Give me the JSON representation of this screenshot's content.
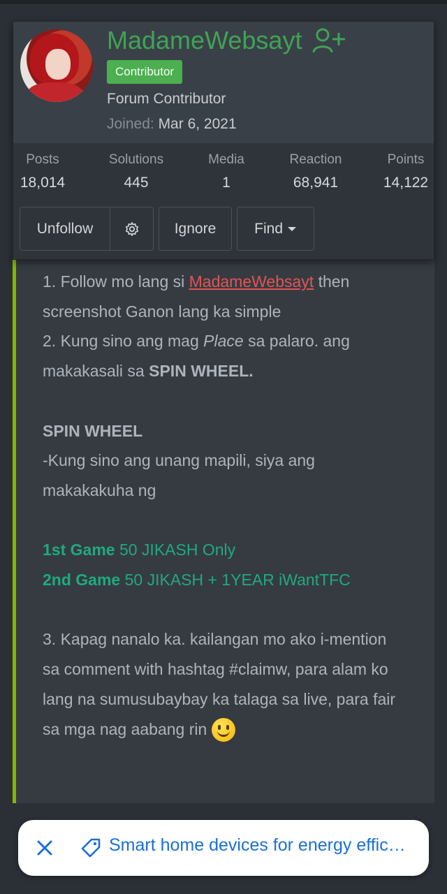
{
  "member": {
    "username": "MadameWebsayt",
    "badge": "Contributor",
    "title": "Forum Contributor",
    "joined_label": "Joined:",
    "joined_date": "Mar 6, 2021",
    "accent_color": "#3fa356"
  },
  "stats": [
    {
      "label": "Posts",
      "value": "18,014"
    },
    {
      "label": "Solutions",
      "value": "445"
    },
    {
      "label": "Media",
      "value": "1"
    },
    {
      "label": "Reaction",
      "value": "68,941"
    },
    {
      "label": "Points",
      "value": "14,122"
    }
  ],
  "actions": {
    "unfollow": "Unfollow",
    "settings_icon": "gear-icon",
    "ignore": "Ignore",
    "find": "Find"
  },
  "post": {
    "l1_a": "1. Follow mo lang si ",
    "l1_mention": "MadameWebsayt",
    "l1_b": " then screenshot Ganon lang ka simple",
    "l2_a": "2. Kung sino ang mag ",
    "l2_em": "Place",
    "l2_b": " sa palaro. ang makakasali sa ",
    "l2_strong": "SPIN WHEEL.",
    "spin_heading": "SPIN WHEEL",
    "spin_desc": "-Kung sino ang unang mapili, siya ang makakakuha ng",
    "game1_label": "1st Game",
    "game1_prize": " 50 JIKASH Only",
    "game2_label": "2nd Game",
    "game2_prize": " 50 JIKASH + 1YEAR iWantTFC",
    "l3": "3. Kapag nanalo ka. kailangan mo ako i-mention sa comment with hashtag #claimw, para alam ko lang na sumusubaybay ka talaga sa live, para fair sa mga nag aabang rin ",
    "emoji": "smiling-face-emoji"
  },
  "suggestion": {
    "text": "Smart home devices for energy effic…",
    "close_icon": "close-icon",
    "tag_icon": "tag-icon"
  }
}
